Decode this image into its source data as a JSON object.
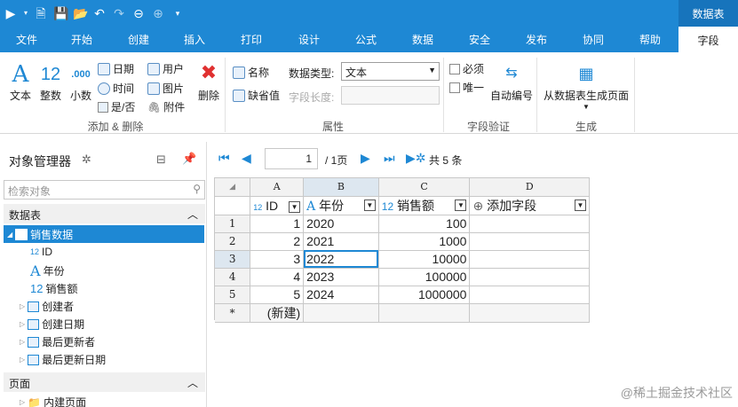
{
  "ribbon_tabs": [
    "文件",
    "开始",
    "创建",
    "插入",
    "打印",
    "设计",
    "公式",
    "数据",
    "安全",
    "发布",
    "协同",
    "帮助",
    "字段"
  ],
  "active_tab": "字段",
  "context_tab": "数据表",
  "groups": {
    "add_delete": {
      "label": "添加 & 删除",
      "text": "文本",
      "integer": "整数",
      "decimal": "小数",
      "date": "日期",
      "time": "时间",
      "yesno": "是/否",
      "user": "用户",
      "image": "图片",
      "attachment": "附件",
      "delete": "删除",
      "integer_glyph": "12",
      "decimal_glyph": ".000"
    },
    "properties": {
      "label": "属性",
      "name": "名称",
      "default_value": "缺省值",
      "data_type_label": "数据类型:",
      "data_type_value": "文本",
      "field_length_label": "字段长度:"
    },
    "validation": {
      "label": "字段验证",
      "required": "必须",
      "unique": "唯一",
      "auto_number": "自动编号"
    },
    "generate": {
      "label": "生成",
      "from_table": "从数据表生成页面"
    }
  },
  "object_manager": {
    "title": "对象管理器",
    "search_placeholder": "检索对象",
    "tables_header": "数据表",
    "table_name": "销售数据",
    "fields": [
      "ID",
      "年份",
      "销售额"
    ],
    "field_glyphs": [
      "12",
      "A",
      "12"
    ],
    "system_fields": [
      "创建者",
      "创建日期",
      "最后更新者",
      "最后更新日期"
    ],
    "pages_header": "页面",
    "pages_item": "内建页面"
  },
  "pager": {
    "current_page": "1",
    "total_pages": "/ 1页",
    "record_count": "共 5 条"
  },
  "grid": {
    "col_letters": [
      "A",
      "B",
      "C",
      "D"
    ],
    "headers": [
      "ID",
      "年份",
      "销售额",
      "添加字段"
    ],
    "header_glyphs": [
      "12",
      "A",
      "12",
      "⊕"
    ],
    "rows": [
      {
        "n": "1",
        "id": "1",
        "year": "2020",
        "sales": "100"
      },
      {
        "n": "2",
        "id": "2",
        "year": "2021",
        "sales": "1000"
      },
      {
        "n": "3",
        "id": "3",
        "year": "2022",
        "sales": "10000"
      },
      {
        "n": "4",
        "id": "4",
        "year": "2023",
        "sales": "100000"
      },
      {
        "n": "5",
        "id": "5",
        "year": "2024",
        "sales": "1000000"
      }
    ],
    "new_row_marker": "*",
    "new_row_label": "(新建)"
  },
  "watermark": "@稀土掘金技术社区",
  "colors": {
    "accent": "#1e88d4",
    "accent_dark": "#1774bc"
  }
}
